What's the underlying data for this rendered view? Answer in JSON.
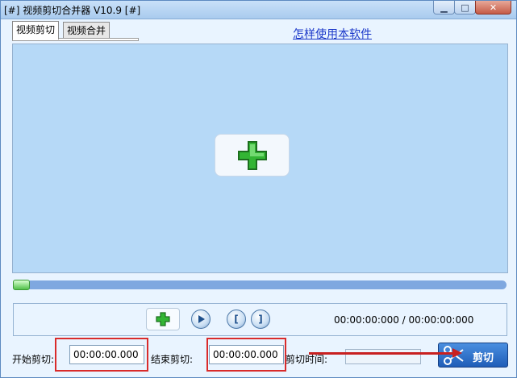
{
  "window": {
    "title": "[#] 视频剪切合并器 V10.9 [#]",
    "controls": {
      "minimize": "▁",
      "maximize": "□",
      "close": "✕"
    }
  },
  "tabs": [
    {
      "label": "视频剪切",
      "active": true
    },
    {
      "label": "视频合并",
      "active": false
    }
  ],
  "help_link": "怎样使用本软件",
  "player": {
    "progress_percent": 0,
    "time_display": "00:00:00:000 / 00:00:00:000",
    "controls": [
      "add-icon",
      "play-icon",
      "mark-in-icon",
      "mark-out-icon"
    ]
  },
  "cut": {
    "start_label": "开始剪切:",
    "start_value": "00:00:00.000",
    "end_label": "结束剪切:",
    "end_value": "00:00:00.000",
    "duration_label": "剪切时间:",
    "duration_value": "",
    "button_label": "剪切"
  },
  "colors": {
    "preview_bg": "#b6d9f7",
    "link": "#1a37c9",
    "highlight": "#d92b2b",
    "progress": "#7fa8e0"
  }
}
